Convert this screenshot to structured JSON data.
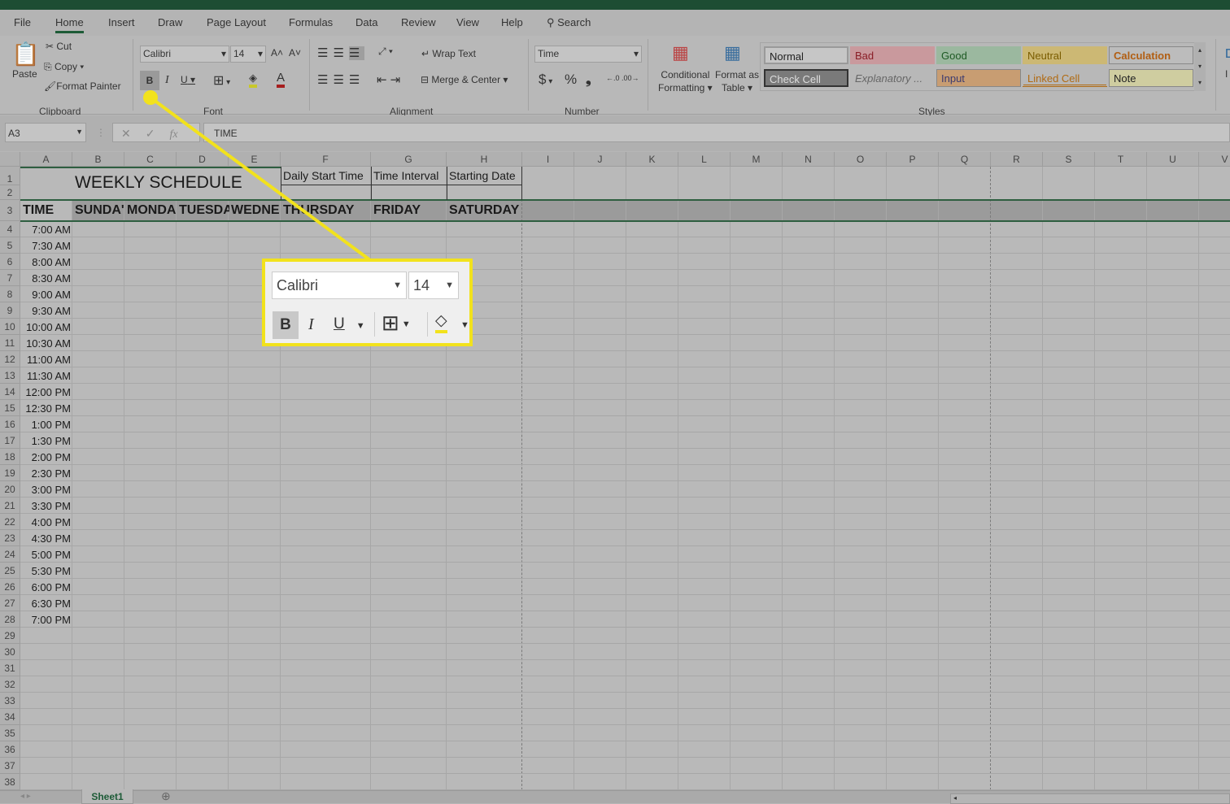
{
  "tabs": [
    "File",
    "Home",
    "Insert",
    "Draw",
    "Page Layout",
    "Formulas",
    "Data",
    "Review",
    "View",
    "Help"
  ],
  "search_label": "Search",
  "clipboard": {
    "paste": "Paste",
    "cut": "Cut",
    "copy": "Copy",
    "format_painter": "Format Painter",
    "group": "Clipboard"
  },
  "font": {
    "name": "Calibri",
    "size": "14",
    "bold": "B",
    "italic": "I",
    "underline": "U",
    "grow": "A˄",
    "shrink": "A˅",
    "color_letter": "A",
    "group": "Font"
  },
  "alignment": {
    "wrap": "Wrap Text",
    "merge": "Merge & Center",
    "group": "Alignment"
  },
  "number": {
    "format": "Time",
    "currency": "$",
    "percent": "%",
    "comma": "❟",
    "group": "Number"
  },
  "styles": {
    "conditional": [
      "Conditional",
      "Formatting ▾"
    ],
    "format_table": [
      "Format as",
      "Table ▾"
    ],
    "group": "Styles",
    "cells": [
      {
        "label": "Normal",
        "bg": "#c6c6c6",
        "fg": "#222"
      },
      {
        "label": "Bad",
        "bg": "#c9999d",
        "fg": "#8a1d26"
      },
      {
        "label": "Good",
        "bg": "#9bb89f",
        "fg": "#1e5a24"
      },
      {
        "label": "Neutral",
        "bg": "#ccb874",
        "fg": "#7a5c00"
      },
      {
        "label": "Calculation",
        "bg": "#bcbcbc",
        "fg": "#b15e12"
      },
      {
        "label": "Check Cell",
        "bg": "#7a7a7a",
        "fg": "#ddd"
      },
      {
        "label": "Explanatory ...",
        "bg": "transparent",
        "fg": "#666"
      },
      {
        "label": "Input",
        "bg": "#c89d72",
        "fg": "#3a3a70"
      },
      {
        "label": "Linked Cell",
        "bg": "transparent",
        "fg": "#b06a12"
      },
      {
        "label": "Note",
        "bg": "#cfcda0",
        "fg": "#222"
      }
    ]
  },
  "insert_partial": "I",
  "formula_bar": {
    "name_box": "A3",
    "formula": "TIME",
    "fx": "fx"
  },
  "columns": [
    "A",
    "B",
    "C",
    "D",
    "E",
    "F",
    "G",
    "H",
    "I",
    "J",
    "K",
    "L",
    "M",
    "N",
    "O",
    "P",
    "Q",
    "R",
    "S",
    "T",
    "U",
    "V"
  ],
  "sheet": {
    "title": "WEEKLY SCHEDULE",
    "labels": [
      "Daily Start Time",
      "Time Interval",
      "Starting Date"
    ],
    "headers": [
      "TIME",
      "SUNDA'",
      "MONDA",
      "TUESDA",
      "WEDNE",
      "THURSDAY",
      "FRIDAY",
      "SATURDAY"
    ],
    "times": [
      "7:00 AM",
      "7:30 AM",
      "8:00 AM",
      "8:30 AM",
      "9:00 AM",
      "9:30 AM",
      "10:00 AM",
      "10:30 AM",
      "11:00 AM",
      "11:30 AM",
      "12:00 PM",
      "12:30 PM",
      "1:00 PM",
      "1:30 PM",
      "2:00 PM",
      "2:30 PM",
      "3:00 PM",
      "3:30 PM",
      "4:00 PM",
      "4:30 PM",
      "5:00 PM",
      "5:30 PM",
      "6:00 PM",
      "6:30 PM",
      "7:00 PM"
    ]
  },
  "sheet_tab": "Sheet1",
  "callout": {
    "font": "Calibri",
    "size": "14",
    "bold": "B",
    "italic": "I",
    "underline": "U",
    "highlight": "#f2e21c"
  }
}
